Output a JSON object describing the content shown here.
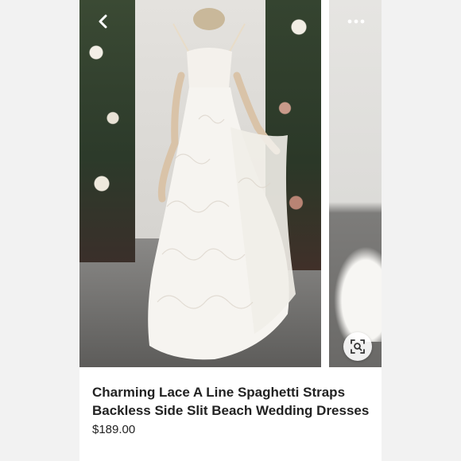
{
  "listing": {
    "title": "Charming Lace A Line Spaghetti Straps Backless Side Slit Beach Wedding Dresses",
    "price": "$189.00"
  },
  "icons": {
    "back": "chevron-left-icon",
    "more": "more-horizontal-icon",
    "visual_search": "visual-search-icon"
  },
  "colors": {
    "page_background": "#f2f2f2",
    "card_background": "#ffffff",
    "text": "#222222"
  }
}
